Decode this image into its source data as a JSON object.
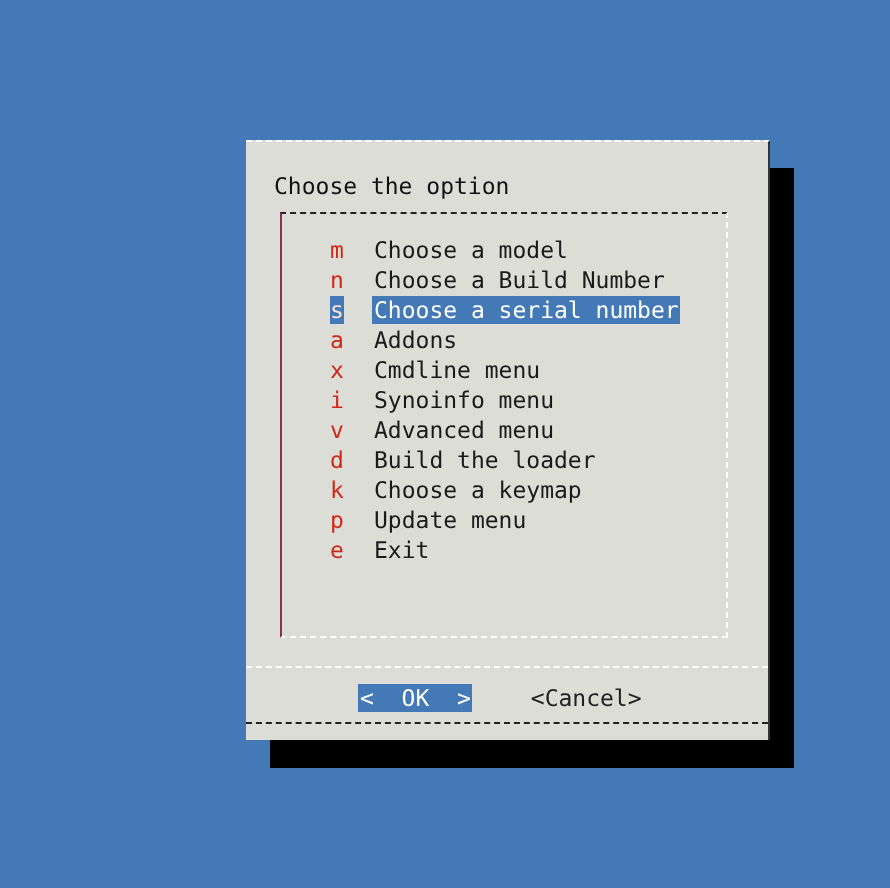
{
  "dialog": {
    "title": "Choose the option"
  },
  "menu": [
    {
      "key": "m",
      "label": "Choose a model",
      "selected": false
    },
    {
      "key": "n",
      "label": "Choose a Build Number",
      "selected": false
    },
    {
      "key": "s",
      "label": "Choose a serial number",
      "selected": true
    },
    {
      "key": "a",
      "label": "Addons",
      "selected": false
    },
    {
      "key": "x",
      "label": "Cmdline menu",
      "selected": false
    },
    {
      "key": "i",
      "label": "Synoinfo menu",
      "selected": false
    },
    {
      "key": "v",
      "label": "Advanced menu",
      "selected": false
    },
    {
      "key": "d",
      "label": "Build the loader",
      "selected": false
    },
    {
      "key": "k",
      "label": "Choose a keymap",
      "selected": false
    },
    {
      "key": "p",
      "label": "Update menu",
      "selected": false
    },
    {
      "key": "e",
      "label": "Exit",
      "selected": false
    }
  ],
  "buttons": [
    {
      "label": "<  OK  >",
      "selected": true
    },
    {
      "label": "<Cancel>",
      "selected": false
    }
  ]
}
